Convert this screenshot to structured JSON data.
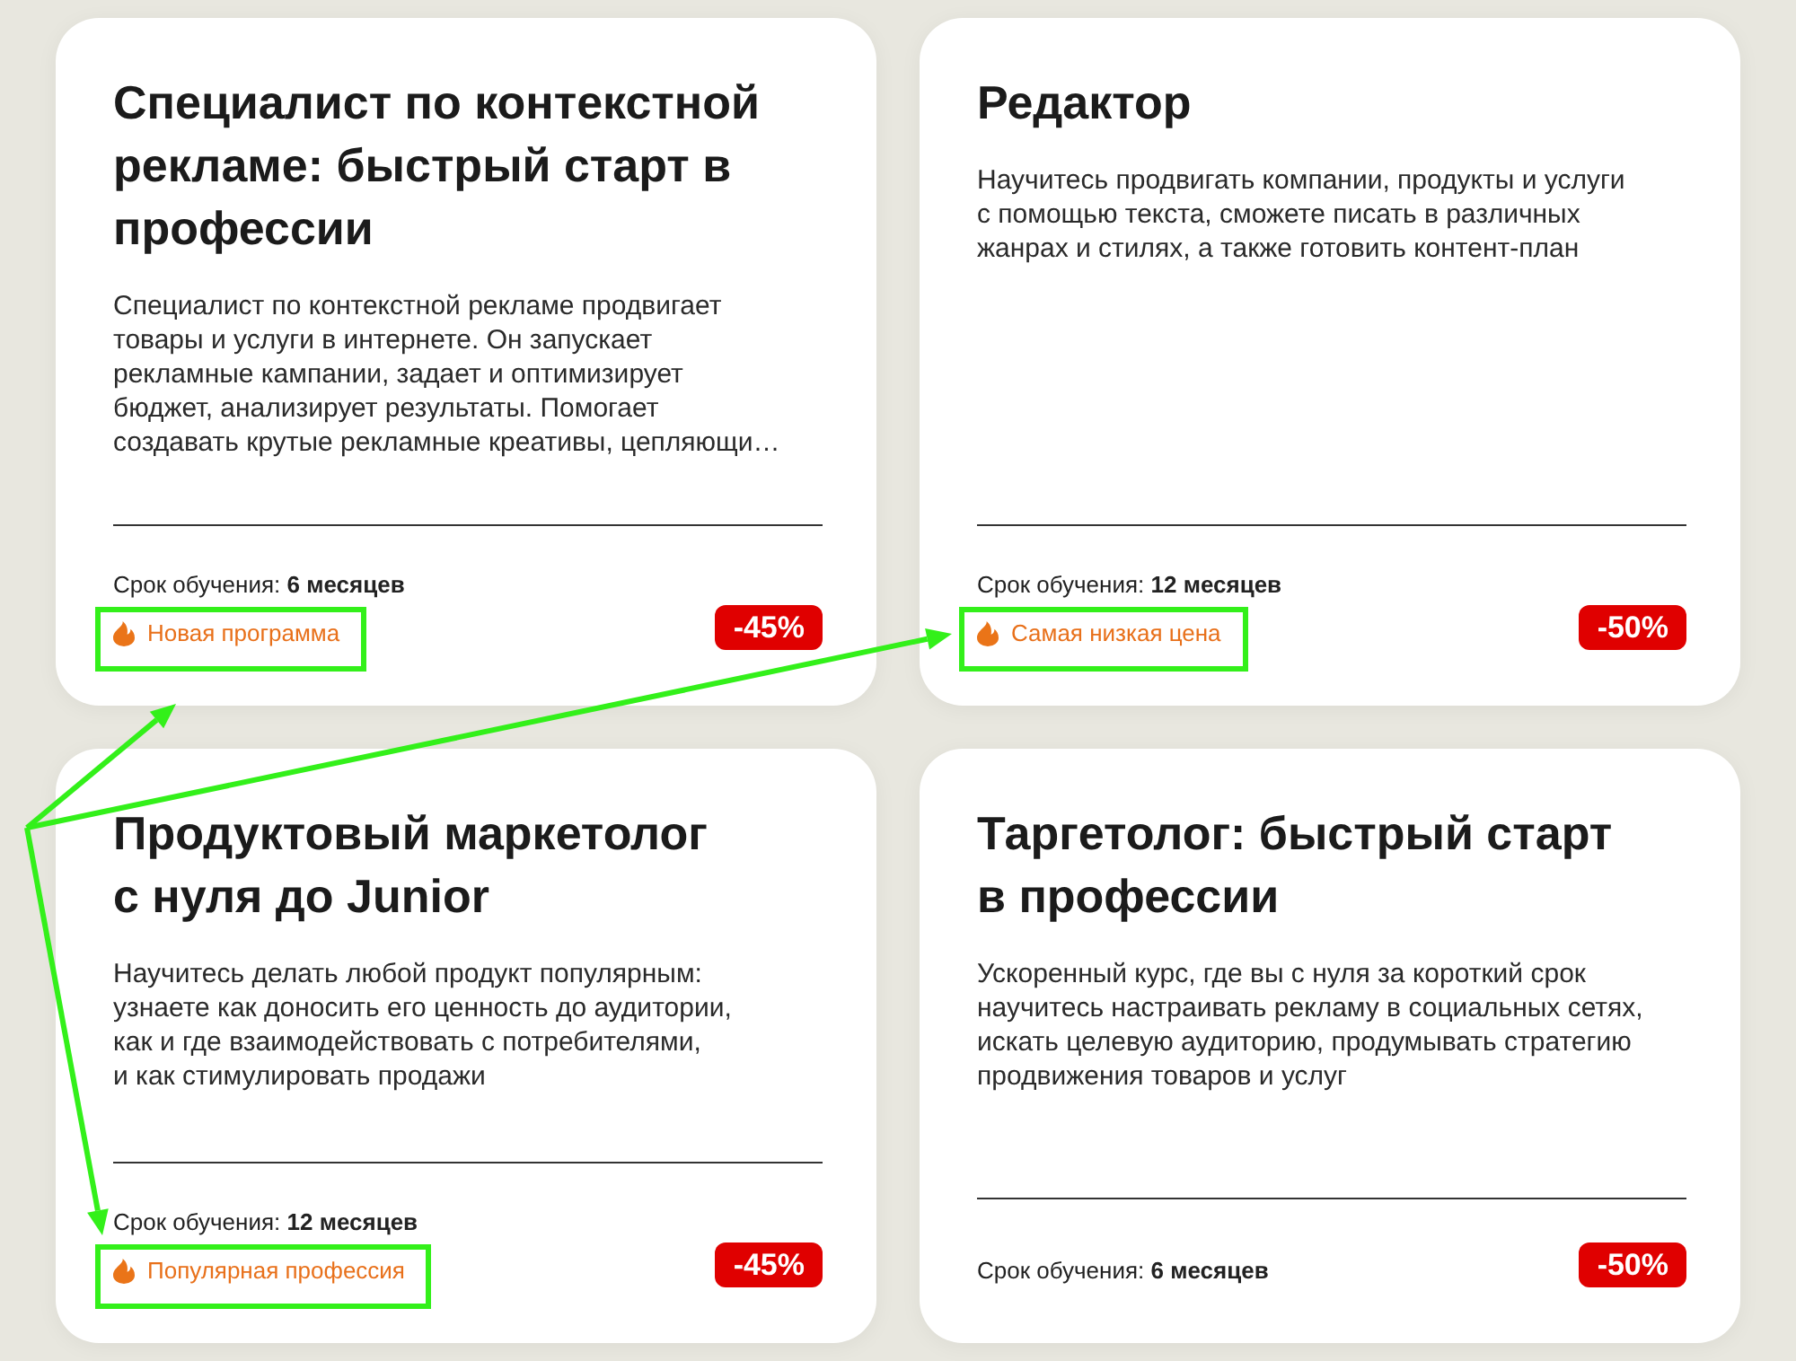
{
  "cards": [
    {
      "title": "Специалист по контекстной\nрекламе: быстрый старт в\nпрофессии",
      "description": "Специалист по контекстной рекламе продвигает\nтовары и услуги в интернете. Он запускает\nрекламные кампании, задает и оптимизирует\nбюджет, анализирует результаты. Помогает\nсоздавать крутые рекламные креативы, цепляющи…",
      "duration": {
        "label": "Срок обучения:",
        "value": "6 месяцев"
      },
      "badge": {
        "text": "Новая программа",
        "highlighted": true
      },
      "discount": "-45%"
    },
    {
      "title": "Редактор",
      "description": "Научитесь продвигать компании, продукты и услуги\nс помощью текста, сможете писать в различных\nжанрах и стилях, а также готовить контент-план",
      "duration": {
        "label": "Срок обучения:",
        "value": "12 месяцев"
      },
      "badge": {
        "text": "Самая низкая цена",
        "highlighted": true
      },
      "discount": "-50%"
    },
    {
      "title": "Продуктовый маркетолог\nс нуля до Junior",
      "description": "Научитесь делать любой продукт популярным:\nузнаете как доносить его ценность до аудитории,\nкак и где взаимодействовать с потребителями,\nи как стимулировать продажи",
      "duration": {
        "label": "Срок обучения:",
        "value": "12 месяцев"
      },
      "badge": {
        "text": "Популярная профессия",
        "highlighted": true
      },
      "discount": "-45%"
    },
    {
      "title": "Таргетолог: быстрый старт\nв профессии",
      "description": "Ускоренный курс, где вы с нуля за короткий срок\nнаучитесь настраивать рекламу в социальных сетях,\nискать целевую аудиторию, продумывать стратегию\nпродвижения товаров и услуг",
      "duration": {
        "label": "Срок обучения:",
        "value": "6 месяцев"
      },
      "discount": "-50%"
    }
  ]
}
